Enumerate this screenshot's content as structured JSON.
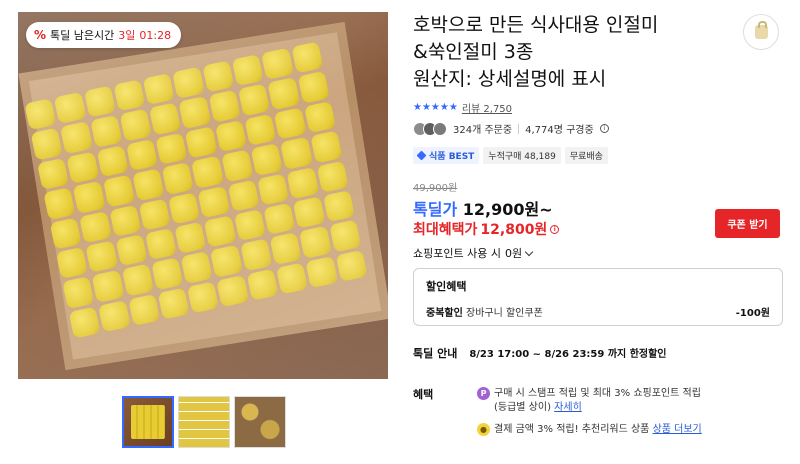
{
  "image": {
    "timer_badge": {
      "icon": "percent-icon",
      "label": "톡딜 남은시간",
      "days": "3일",
      "time": "01:28"
    },
    "thumbnails": [
      "thumb-1",
      "thumb-2",
      "thumb-3"
    ]
  },
  "product": {
    "title": "호박으로 만든 식사대용 인절미\n&쑥인절미 3종\n원산지: 상세설명에 표시",
    "rating_stars": "★★★★★",
    "review_label": "리뷰 2,750",
    "order_count": "324개 주문중",
    "view_count": "4,774명 구경중",
    "tags": {
      "best": "식품 BEST",
      "cumulative": "누적구매 48,189",
      "shipping": "무료배송"
    }
  },
  "price": {
    "original": "49,900원",
    "deal_label": "톡딜가",
    "deal_value": "12,900원~",
    "max_label": "최대혜택가",
    "max_value": "12,800원",
    "coupon_button": "쿠폰 받기",
    "points_label": "쇼핑포인트 사용 시",
    "points_value": "0원"
  },
  "discount": {
    "heading": "할인혜택",
    "row_label": "중복할인",
    "row_desc": "장바구니 할인쿠폰",
    "row_amount": "-100원"
  },
  "deal": {
    "label": "톡딜 안내",
    "period": "8/23 17:00 ~ 8/26 23:59 까지 한정할인"
  },
  "benefits": {
    "label": "혜택",
    "b1_text": "구매 시 스탬프 적립 및 최대 3% 쇼핑포인트 적립",
    "b1_sub": "(등급별 상이)",
    "b1_link": "자세히",
    "b2_text": "결제 금액 3% 적립! 추천리워드 상품",
    "b2_link": "상품 더보기"
  },
  "colors": {
    "accent_blue": "#346aff",
    "sale_red": "#e52528"
  }
}
